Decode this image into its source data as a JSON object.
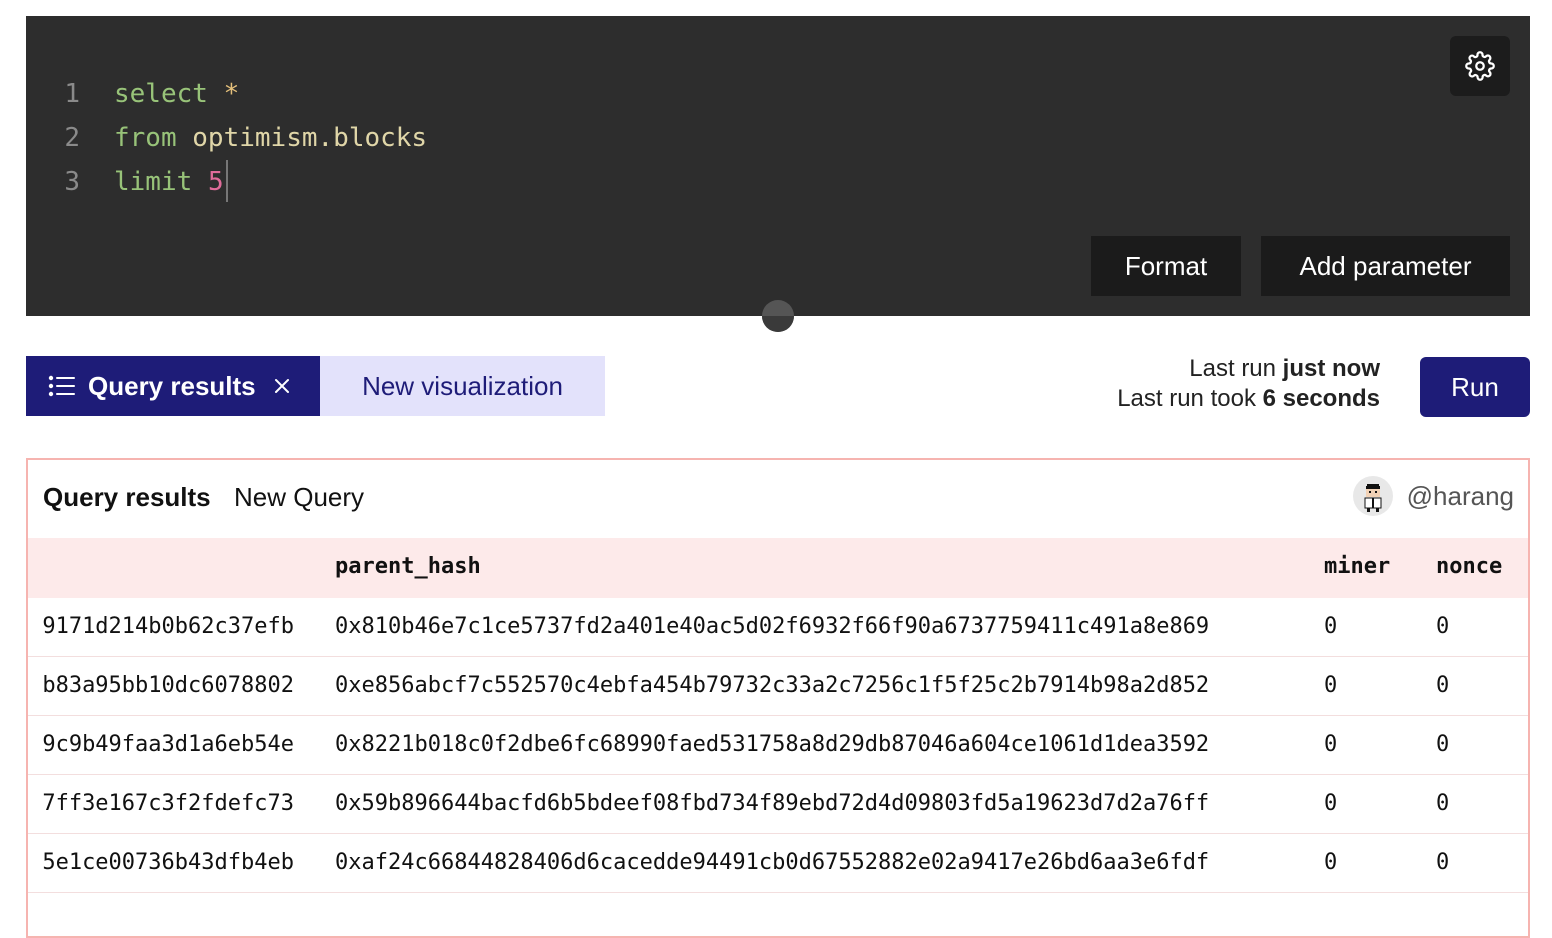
{
  "editor": {
    "lines": [
      {
        "num": "1",
        "parts": [
          {
            "t": "kw",
            "v": "select"
          },
          {
            "t": "sp",
            "v": " "
          },
          {
            "t": "op",
            "v": "*"
          }
        ]
      },
      {
        "num": "2",
        "parts": [
          {
            "t": "kw",
            "v": "from"
          },
          {
            "t": "sp",
            "v": " "
          },
          {
            "t": "id",
            "v": "optimism.blocks"
          }
        ]
      },
      {
        "num": "3",
        "parts": [
          {
            "t": "kw",
            "v": "limit"
          },
          {
            "t": "sp",
            "v": " "
          },
          {
            "t": "num",
            "v": "5"
          }
        ]
      }
    ],
    "format_label": "Format",
    "add_parameter_label": "Add parameter"
  },
  "tabs": {
    "active_label": "Query results",
    "new_visualization_label": "New visualization"
  },
  "run": {
    "last_run_prefix": "Last run",
    "last_run_value": "just now",
    "last_run_took_prefix": "Last run took",
    "last_run_took_value": "6 seconds",
    "run_label": "Run"
  },
  "results": {
    "title": "Query results",
    "query_name": "New Query",
    "username": "@harang",
    "columns": [
      "parent_hash",
      "miner",
      "nonce"
    ],
    "rows": [
      {
        "hash": "9171d214b0b62c37efb",
        "parent_hash": "0x810b46e7c1ce5737fd2a401e40ac5d02f6932f66f90a6737759411c491a8e869",
        "miner": "0",
        "nonce": "0"
      },
      {
        "hash": "b83a95bb10dc6078802",
        "parent_hash": "0xe856abcf7c552570c4ebfa454b79732c33a2c7256c1f5f25c2b7914b98a2d852",
        "miner": "0",
        "nonce": "0"
      },
      {
        "hash": "9c9b49faa3d1a6eb54e",
        "parent_hash": "0x8221b018c0f2dbe6fc68990faed531758a8d29db87046a604ce1061d1dea3592",
        "miner": "0",
        "nonce": "0"
      },
      {
        "hash": "7ff3e167c3f2fdefc73",
        "parent_hash": "0x59b896644bacfd6b5bdeef08fbd734f89ebd72d4d09803fd5a19623d7d2a76ff",
        "miner": "0",
        "nonce": "0"
      },
      {
        "hash": "5e1ce00736b43dfb4eb",
        "parent_hash": "0xaf24c66844828406d6cacedde94491cb0d67552882e02a9417e26bd6aa3e6fdf",
        "miner": "0",
        "nonce": "0"
      }
    ]
  },
  "colors": {
    "editor_bg": "#2d2d2d",
    "accent": "#1e1c78",
    "tab_inactive_bg": "#e3e2fb",
    "table_header_bg": "#fdeaea",
    "panel_border": "#f6b4b0"
  }
}
